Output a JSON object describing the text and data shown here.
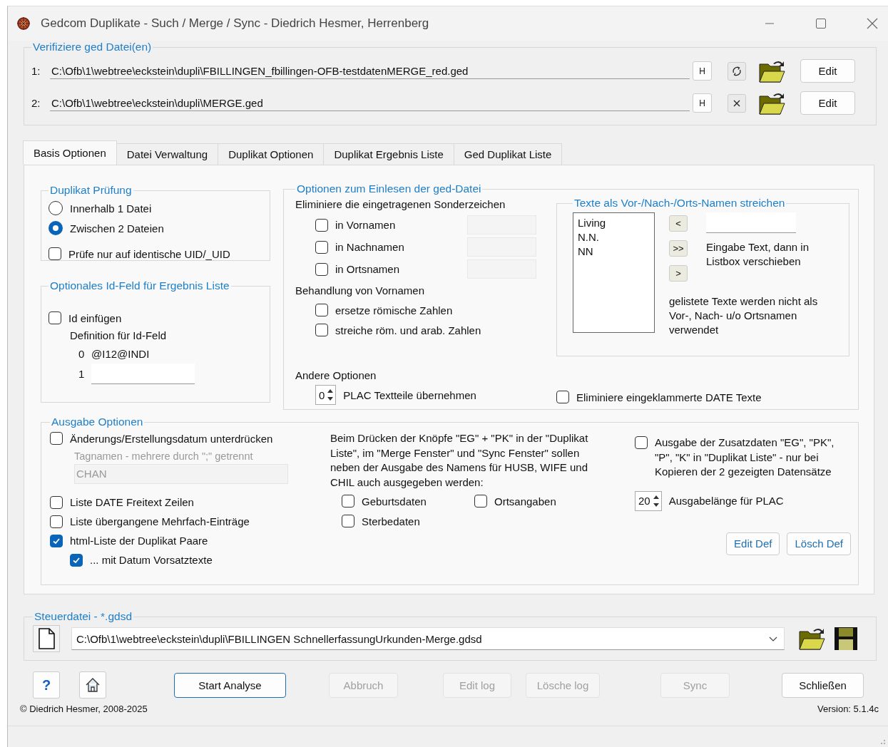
{
  "window": {
    "title": "Gedcom Duplikate - Such / Merge / Sync  -  Diedrich Hesmer, Herrenberg"
  },
  "files": {
    "legend": "Verifiziere ged Datei(en)",
    "rows": [
      {
        "number": "1:",
        "path": "C:\\Ofb\\1\\webtree\\eckstein\\dupli\\FBILLINGEN_fbillingen-OFB-testdatenMERGE_red.ged",
        "h_button": "H",
        "kind": "reload",
        "edit": "Edit"
      },
      {
        "number": "2:",
        "path": "C:\\Ofb\\1\\webtree\\eckstein\\dupli\\MERGE.ged",
        "h_button": "H",
        "kind": "clear",
        "edit": "Edit"
      }
    ]
  },
  "tabs": [
    {
      "label": "Basis Optionen",
      "selected": true
    },
    {
      "label": "Datei Verwaltung",
      "selected": false
    },
    {
      "label": "Duplikat Optionen",
      "selected": false
    },
    {
      "label": "Duplikat Ergebnis Liste",
      "selected": false
    },
    {
      "label": "Ged Duplikat Liste",
      "selected": false
    }
  ],
  "duplicate_check": {
    "legend": "Duplikat Prüfung",
    "radios": [
      {
        "label": "Innerhalb 1 Datei",
        "selected": false
      },
      {
        "label": "Zwischen 2 Dateien",
        "selected": true
      }
    ],
    "uid_check": {
      "label": "Prüfe nur auf identische UID/_UID",
      "checked": false
    }
  },
  "id_field": {
    "legend": "Optionales Id-Feld für Ergebnis Liste",
    "insert": {
      "label": "Id einfügen",
      "checked": false
    },
    "definition_label": "Definition für Id-Feld",
    "line_0": {
      "number": "0",
      "value": "@I12@INDI"
    },
    "line_1": {
      "number": "1"
    }
  },
  "read_options": {
    "legend": "Optionen zum Einlesen der ged-Datei",
    "special_heading": "Eliminiere die eingetragenen Sonderzeichen",
    "special_items": [
      {
        "label": "in Vornamen",
        "checked": false
      },
      {
        "label": "in Nachnamen",
        "checked": false
      },
      {
        "label": "in Ortsnamen",
        "checked": false
      }
    ],
    "first_name_heading": "Behandlung von Vornamen",
    "first_name_items": [
      {
        "label": "ersetze römische Zahlen",
        "checked": false
      },
      {
        "label": "streiche röm. und arab. Zahlen",
        "checked": false
      }
    ],
    "other_heading": "Andere Optionen",
    "plac_parts": {
      "value": "0",
      "label": "PLAC Textteile übernehmen"
    },
    "date_brackets": {
      "label": "Eliminiere eingeklammerte DATE Texte",
      "checked": false
    }
  },
  "strike_texts": {
    "legend": "Texte als Vor-/Nach-/Orts-Namen streichen",
    "list": [
      "Living",
      "N.N.",
      "NN"
    ],
    "buttons": [
      "<",
      ">>",
      ">"
    ],
    "hint": "Eingabe Text, dann in Listbox verschieben",
    "note": "gelistete Texte werden nicht als Vor-, Nach- u/o Ortsnamen verwendet"
  },
  "output": {
    "legend": "Ausgabe Optionen",
    "suppress_dates": {
      "label": "Änderungs/Erstellungsdatum unterdrücken",
      "checked": false
    },
    "tag_hint": "Tagnamen - mehrere durch \";\" getrennt",
    "tag_value": "CHAN",
    "tag_disabled": true,
    "checks": [
      {
        "label": "Liste DATE Freitext Zeilen",
        "checked": false
      },
      {
        "label": "Liste übergangene Mehrfach-Einträge",
        "checked": false
      },
      {
        "label": "html-Liste der Duplikat Paare",
        "checked": true
      },
      {
        "label": "... mit Datum Vorsatztexte",
        "checked": true,
        "kind": "sub"
      }
    ],
    "explanation": "Beim Drücken der Knöpfe \"EG\" + \"PK\" in der \"Duplikat Liste\", im \"Merge Fenster\" und \"Sync Fenster\" sollen neben der Ausgabe des Namens für HUSB, WIFE und CHIL auch ausgegeben werden:",
    "extra_fields": [
      {
        "label": "Geburtsdaten",
        "checked": false
      },
      {
        "label": "Ortsangaben",
        "checked": false
      },
      {
        "label": "Sterbedaten",
        "checked": false
      }
    ],
    "extra_output": {
      "label": "Ausgabe der Zusatzdaten \"EG\", \"PK\", \"P\", \"K\" in \"Duplikat Liste\" - nur bei Kopieren der 2 gezeigten Datensätze",
      "checked": false
    },
    "plac_length": {
      "value": "20",
      "label": "Ausgabelänge für PLAC"
    },
    "buttons": [
      "Edit Def",
      "Lösch Def"
    ]
  },
  "control_file": {
    "legend": "Steuerdatei - *.gdsd",
    "path": "C:\\Ofb\\1\\webtree\\eckstein\\dupli\\FBILLINGEN SchnellerfassungUrkunden-Merge.gdsd"
  },
  "help_button": "?",
  "buttons": [
    {
      "label": "Start Analyse",
      "disabled": false,
      "kind": "default"
    },
    {
      "label": "Abbruch",
      "disabled": true,
      "kind": "normal"
    },
    {
      "label": "Edit log",
      "disabled": true,
      "kind": "normal"
    },
    {
      "label": "Lösche log",
      "disabled": true,
      "kind": "normal"
    },
    {
      "label": "Sync",
      "disabled": true,
      "kind": "normal"
    },
    {
      "label": "Schließen",
      "disabled": false,
      "kind": "normal"
    }
  ],
  "footer": {
    "copyright": "© Diedrich Hesmer,  2008-2025",
    "version": "Version: 5.1.4c"
  }
}
